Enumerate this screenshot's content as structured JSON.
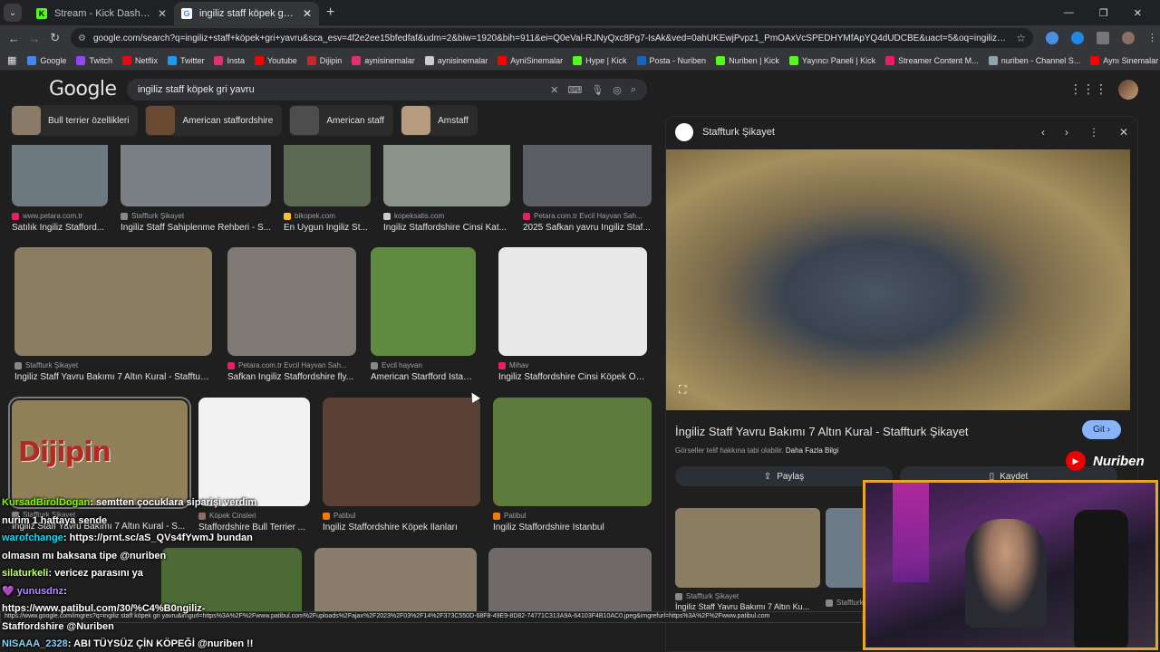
{
  "browser": {
    "tabs": [
      {
        "title": "Stream - Kick Dashboard",
        "fav_color": "#53fc18",
        "fav_letter": "K"
      },
      {
        "title": "ingiliz staff köpek gri yavru - Go",
        "fav_color": "#ffffff",
        "fav_letter": "G"
      }
    ],
    "url": "google.com/search?q=ingiliz+staff+köpek+gri+yavru&sca_esv=4f2e2ee15bfedfaf&udm=2&biw=1920&bih=911&ei=Q0eVal-RJNyQxc8Pg7-IsAk&ved=0ahUKEwjPvpz1_PmOAxVcSPEDHYMfApYQ4dUDCBE&uact=5&oq=ingiliz+staff+köpek+gri..."
  },
  "bookmarks": [
    {
      "label": "Google",
      "color": "#4285f4"
    },
    {
      "label": "Twitch",
      "color": "#9146ff"
    },
    {
      "label": "Netflix",
      "color": "#e50914"
    },
    {
      "label": "Twitter",
      "color": "#1d9bf0"
    },
    {
      "label": "Insta",
      "color": "#e1306c"
    },
    {
      "label": "Youtube",
      "color": "#ff0000"
    },
    {
      "label": "Dijipin",
      "color": "#c62828"
    },
    {
      "label": "aynisinemalar",
      "color": "#e1306c"
    },
    {
      "label": "aynisinemalar",
      "color": "#cccccc"
    },
    {
      "label": "AyniSinemalar",
      "color": "#ff0000"
    },
    {
      "label": "Hype | Kick",
      "color": "#53fc18"
    },
    {
      "label": "Posta - Nuriben",
      "color": "#1565c0"
    },
    {
      "label": "Nuriben | Kick",
      "color": "#53fc18"
    },
    {
      "label": "Yayıncı Paneli | Kick",
      "color": "#53fc18"
    },
    {
      "label": "Streamer Content M...",
      "color": "#e91e63"
    },
    {
      "label": "nuriben - Channel S...",
      "color": "#90a4ae"
    },
    {
      "label": "Aynı Sinemalar - Ça...",
      "color": "#ff0000"
    }
  ],
  "google": {
    "logo": "Google",
    "query": "ingiliz staff köpek gri yavru"
  },
  "chips": [
    {
      "label": "Bull terrier özellikleri",
      "color": "#8a7a68"
    },
    {
      "label": "American staffordshire",
      "color": "#6b4a33"
    },
    {
      "label": "American staff",
      "color": "#4d4d4d"
    },
    {
      "label": "Amstaff",
      "color": "#b69b7e"
    }
  ],
  "results": [
    {
      "src": "www.petara.com.tr",
      "cap": "Satılık İngiliz Stafford...",
      "color": "#6e7a82",
      "fav": "#e91e63"
    },
    {
      "src": "Staffturk Şikayet",
      "cap": "İngiliz Staff Sahiplenme Rehberi - S...",
      "color": "#7b7f86",
      "fav": "#888888"
    },
    {
      "src": "bikopek.com",
      "cap": "En Uygun İngiliz St...",
      "color": "#5a6a52",
      "fav": "#fbc02d"
    },
    {
      "src": "kopeksatis.com",
      "cap": "İngiliz Staffordshire Cinsi Kat...",
      "color": "#8b9488",
      "fav": "#cccccc"
    },
    {
      "src": "Petara.com.tr Evcil Hayvan Sah...",
      "cap": "2025 Safkan yavru İngiliz Staf...",
      "color": "#5b5f63",
      "fav": "#e91e63"
    },
    {
      "src": "Staffturk Şikayet",
      "cap": "İngiliz Staff Yavru Bakımı 7 Altın Kural - Staffturk ...",
      "color": "#8a7d62",
      "fav": "#888888"
    },
    {
      "src": "Petara.com.tr Evcil Hayvan Sah...",
      "cap": "Safkan İngiliz Staffordshire fly...",
      "color": "#807a75",
      "fav": "#e91e63"
    },
    {
      "src": "Evcil hayvan",
      "cap": "American Starfford İstanbul",
      "color": "#5f8a3f",
      "fav": "#888888"
    },
    {
      "src": "Mihav",
      "cap": "İngiliz Staffordshire Cinsi Köpek Öze...",
      "color": "#e8e8e8",
      "fav": "#e91e63"
    },
    {
      "src": "Staffturk Şikayet",
      "cap": "İngiliz Staff Yavru Bakımı 7 Altın Kural - S...",
      "color": "#8f8059",
      "fav": "#888888"
    },
    {
      "src": "Köpek Cinsleri",
      "cap": "Staffordshire Bull Terrier ...",
      "color": "#f2f2f2",
      "fav": "#8d6e63"
    },
    {
      "src": "Patibul",
      "cap": "İngiliz Staffordshire Köpek İlanları",
      "color": "#5a4035",
      "fav": "#f57c00"
    },
    {
      "src": "Patibul",
      "cap": "İngiliz Staffordshire İstanbul",
      "color": "#5e7b3e",
      "fav": "#f57c00"
    },
    {
      "src": "",
      "cap": "",
      "color": "#4c6a35",
      "fav": "#888888"
    },
    {
      "src": "",
      "cap": "",
      "color": "#8a7d6c",
      "fav": "#888888"
    },
    {
      "src": "",
      "cap": "",
      "color": "#6f6a68",
      "fav": "#888888"
    }
  ],
  "panel": {
    "site": "Staffturk Şikayet",
    "title": "İngiliz Staff Yavru Bakımı 7 Altın Kural - Staffturk Şikayet",
    "go_label": "Git",
    "note": "Görseller telif hakkına tabi olabilir.",
    "note_link": "Daha Fazla Bilgi",
    "share_label": "Paylaş",
    "save_label": "Kaydet",
    "related": [
      {
        "src": "Staffturk Şikayet",
        "cap": "İngiliz Staff Yavru Bakımı 7 Altın Ku...",
        "color": "#8a7d62"
      },
      {
        "src": "Staffturk",
        "cap": "",
        "color": "#6d7a88"
      }
    ]
  },
  "stream": {
    "watermark": "Dijipin",
    "channel": "Nuriben",
    "chat": [
      {
        "user": "KursadBirolDogan",
        "msg": ": semtten çocuklara siparişi verdim"
      },
      {
        "user": "",
        "msg": "nurim 1 haftaya sende"
      },
      {
        "user": "warofchange",
        "msg": ": https://prnt.sc/aS_QVs4fYwmJ bundan"
      },
      {
        "user": "",
        "msg": "olmasın mı baksana tipe @nuriben"
      },
      {
        "user": "silaturkeli",
        "msg": ": vericez parasını ya"
      },
      {
        "user": "yunusdnz",
        "msg": ":"
      },
      {
        "user": "",
        "msg": "https://www.patibul.com/30/%C4%B0ngiliz-"
      },
      {
        "user": "",
        "msg": "Staffordshire @Nuriben"
      },
      {
        "user": "NISAAA_2328",
        "msg": ": ABI TÜYSÜZ ÇİN KÖPEĞİ @nuriben !!"
      }
    ],
    "status_url": "https://www.google.com/imgres?q=ingiliz staff köpek gri yavru&imgurl=https%3A%2F%2Fwww.patibul.com%2Fuploads%2Fajax%2F2023%2F03%2F14%2F373C550D-68F8-49E9-8D82-74771C313A9A-64103F4B10AC0.jpeg&imgrefurl=https%3A%2F%2Fwww.patibul.com"
  }
}
